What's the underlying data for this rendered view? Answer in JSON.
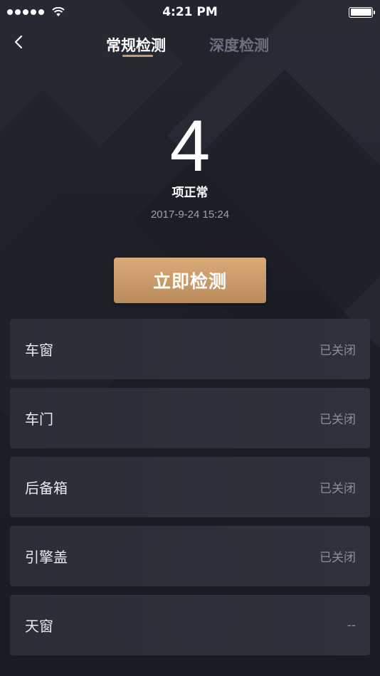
{
  "status_bar": {
    "time": "4:21 PM"
  },
  "nav": {
    "tabs": [
      {
        "label": "常规检测",
        "active": true
      },
      {
        "label": "深度检测",
        "active": false
      }
    ]
  },
  "summary": {
    "count": "4",
    "label": "项正常",
    "timestamp": "2017-9-24 15:24"
  },
  "actions": {
    "detect_label": "立即检测"
  },
  "items": [
    {
      "name": "车窗",
      "status": "已关闭"
    },
    {
      "name": "车门",
      "status": "已关闭"
    },
    {
      "name": "后备箱",
      "status": "已关闭"
    },
    {
      "name": "引擎盖",
      "status": "已关闭"
    },
    {
      "name": "天窗",
      "status": "--"
    }
  ],
  "colors": {
    "accent": "#c79b6d",
    "background": "#1c1e26",
    "card": "#2d2f3a"
  },
  "icons": [
    "signal-dots-icon",
    "wifi-icon",
    "battery-icon",
    "back-arrow-icon"
  ]
}
